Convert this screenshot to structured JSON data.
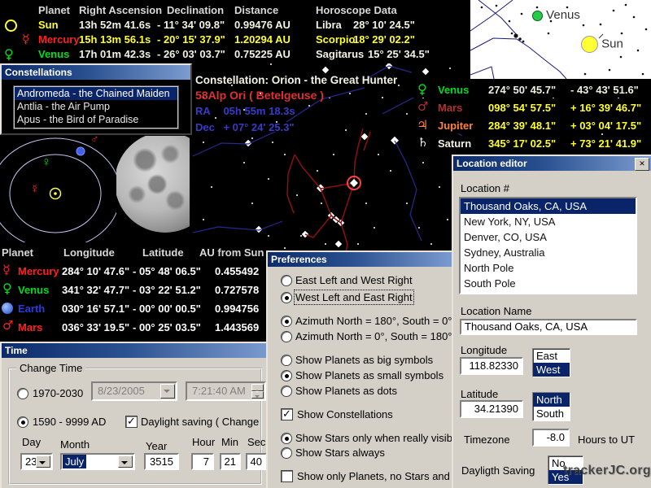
{
  "colors": {
    "titlebar_gradient_start": "#0c2a6a",
    "titlebar_gradient_end": "#7c9cd0",
    "window_bg": "#d4d0c8",
    "selection_bg": "#0a246a",
    "yellow_text": "#ffff2a",
    "white_text": "#ffffff",
    "red_text": "#ff2020",
    "green_text": "#00dd20",
    "blue_text": "#3a3ac8",
    "orange_text": "#ff8040"
  },
  "symbols": {
    "sun": "☉",
    "mercury": "☿",
    "venus": "♀",
    "earth": "⊕",
    "mars": "♂",
    "jupiter": "♃",
    "saturn": "♄"
  },
  "ephemeris_table": {
    "headers": {
      "planet": "Planet",
      "ra": "Right Ascension",
      "dec": "Declination",
      "distance": "Distance",
      "horoscope": "Horoscope Data"
    },
    "rows": [
      {
        "name": "Sun",
        "ra": "13h 52m 41.6s",
        "dec": "- 11° 34' 09.8\"",
        "distance": "0.99476 AU",
        "sign": "Libra",
        "sign_deg": "28° 10' 24.5\""
      },
      {
        "name": "Mercury",
        "ra": "15h 13m 56.1s",
        "dec": "- 20° 15' 37.9\"",
        "distance": "1.20294 AU",
        "sign": "Scorpio",
        "sign_deg": "18° 29' 02.2\""
      },
      {
        "name": "Venus",
        "ra": "17h 01m 42.3s",
        "dec": "- 26° 03' 03.7\"",
        "distance": "0.75225 AU",
        "sign": "Sagitarus",
        "sign_deg": "15° 25' 34.5\""
      }
    ]
  },
  "sky_chart": {
    "venus_label": "Venus",
    "sun_label": "Sun"
  },
  "constellations_window": {
    "title": "Constellations",
    "items": [
      {
        "label": "Andromeda - the Chained Maiden",
        "selected": true
      },
      {
        "label": "Antlia - the Air Pump",
        "selected": false
      },
      {
        "label": "Apus - the Bird of Paradise",
        "selected": false
      }
    ]
  },
  "orion_overlay": {
    "title": "Constellation: Orion - the Great Hunter",
    "star_line": "58Alp Ori  ( Betelgeuse )",
    "ra_label": "RA",
    "ra_value": "05h 55m 18.3s",
    "dec_label": "Dec",
    "dec_value": "+ 07° 24' 25.3\""
  },
  "planet_coords": {
    "rows": [
      {
        "name": "Venus",
        "lon": "274° 50' 45.7\"",
        "lat": "- 43° 43' 51.6\""
      },
      {
        "name": "Mars",
        "lon": "098° 54' 57.5\"",
        "lat": "+ 16° 39' 46.7\""
      },
      {
        "name": "Jupiter",
        "lon": "284° 39' 48.1\"",
        "lat": "+ 03° 04' 17.5\""
      },
      {
        "name": "Saturn",
        "lon": "345° 17' 02.5\"",
        "lat": "+ 73° 21' 41.9\""
      }
    ]
  },
  "heliocentric_table": {
    "headers": {
      "planet": "Planet",
      "longitude": "Longitude",
      "latitude": "Latitude",
      "au": "AU from Sun"
    },
    "rows": [
      {
        "name": "Mercury",
        "lon": "284° 10' 47.6\"",
        "lat": "- 05° 48' 06.5\"",
        "au": "0.455492"
      },
      {
        "name": "Venus",
        "lon": "341° 32' 47.7\"",
        "lat": "- 03° 22' 51.2\"",
        "au": "0.727578"
      },
      {
        "name": "Earth",
        "lon": "030° 16' 57.1\"",
        "lat": "- 00° 00' 00.5\"",
        "au": "0.994756"
      },
      {
        "name": "Mars",
        "lon": "036° 33' 19.5\"",
        "lat": "- 00° 25' 03.5\"",
        "au": "1.443569"
      }
    ]
  },
  "time_window": {
    "title": "Time",
    "group_label": "Change Time",
    "radio_range_1": {
      "label": "1970-2030",
      "selected": false
    },
    "date_value": "8/23/2005",
    "time_value": "7:21:40 AM",
    "radio_range_2": {
      "label": "1590 - 9999 AD",
      "selected": true
    },
    "daylight": {
      "label": "Daylight saving ( Change",
      "checked": true
    },
    "labels": {
      "day": "Day",
      "month": "Month",
      "year": "Year",
      "hour": "Hour",
      "min": "Min",
      "sec": "Sec"
    },
    "values": {
      "day": "23",
      "month": "July",
      "year": "3515",
      "hour": "7",
      "min": "21",
      "sec": "40"
    }
  },
  "preferences_window": {
    "title": "Preferences",
    "items": [
      {
        "label": "East Left and West Right",
        "type": "radio",
        "selected": false
      },
      {
        "label": "West Left and East Right",
        "type": "radio",
        "selected": true
      },
      {
        "label": "Azimuth North = 180°, South = 0°",
        "type": "radio",
        "selected": true
      },
      {
        "label": "Azimuth North = 0°, South = 180°",
        "type": "radio",
        "selected": false
      },
      {
        "label": "Show Planets as big symbols",
        "type": "radio",
        "selected": false
      },
      {
        "label": "Show Planets as small symbols",
        "type": "radio",
        "selected": true
      },
      {
        "label": "Show Planets as dots",
        "type": "radio",
        "selected": false
      },
      {
        "label": "Show Constellations",
        "type": "checkbox",
        "checked": true
      },
      {
        "label": "Show Stars only when really visible",
        "type": "radio",
        "selected": true
      },
      {
        "label": "Show Stars always",
        "type": "radio",
        "selected": false
      },
      {
        "label": "Show only Planets, no Stars and no (",
        "type": "checkbox",
        "checked": false
      }
    ]
  },
  "location_editor": {
    "title": "Location editor",
    "list_label": "Location #",
    "locations": [
      {
        "label": "Thousand Oaks, CA, USA",
        "selected": true
      },
      {
        "label": "New York, NY, USA",
        "selected": false
      },
      {
        "label": "Denver, CO, USA",
        "selected": false
      },
      {
        "label": "Sydney, Australia",
        "selected": false
      },
      {
        "label": "North Pole",
        "selected": false
      },
      {
        "label": "South Pole",
        "selected": false
      }
    ],
    "name_label": "Location Name",
    "name_value": "Thousand Oaks, CA, USA",
    "longitude_label": "Longitude",
    "longitude_value": "118.82330",
    "longitude_options": [
      {
        "label": "East",
        "selected": false
      },
      {
        "label": "West",
        "selected": true
      }
    ],
    "latitude_label": "Latitude",
    "latitude_value": "34.21390",
    "latitude_options": [
      {
        "label": "North",
        "selected": true
      },
      {
        "label": "South",
        "selected": false
      }
    ],
    "timezone_label": "Timezone",
    "timezone_value": "-8.0",
    "timezone_suffix": "Hours to UT",
    "daylight_label": "Dayligth Saving",
    "daylight_options": [
      {
        "label": "No",
        "selected": false
      },
      {
        "label": "Yes",
        "selected": true
      }
    ]
  },
  "watermark": "trackerJC.org"
}
